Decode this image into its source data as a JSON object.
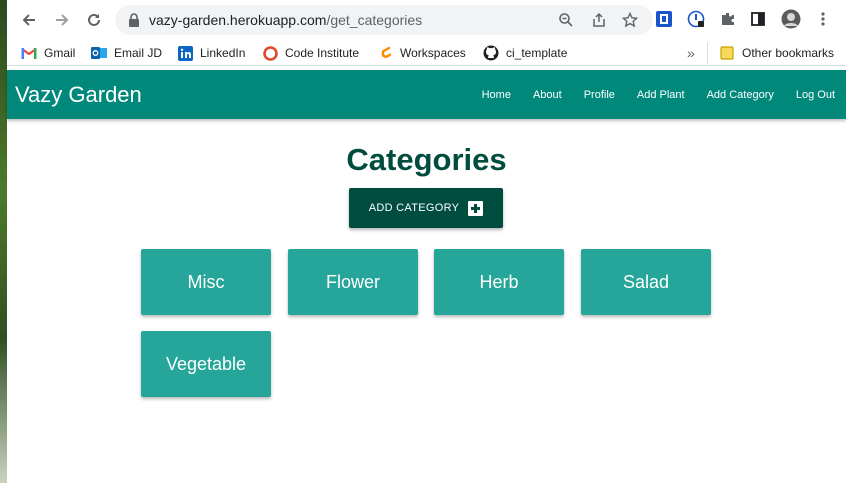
{
  "browser": {
    "url_domain": "vazy-garden.herokuapp.com",
    "url_path": "/get_categories",
    "bookmarks": [
      {
        "label": "Gmail",
        "icon": "gmail-icon"
      },
      {
        "label": "Email JD",
        "icon": "outlook-icon"
      },
      {
        "label": "LinkedIn",
        "icon": "linkedin-icon"
      },
      {
        "label": "Code Institute",
        "icon": "code-institute-icon"
      },
      {
        "label": "Workspaces",
        "icon": "gitpod-icon"
      },
      {
        "label": "ci_template",
        "icon": "github-icon"
      }
    ],
    "overflow_label": "»",
    "other_bookmarks": "Other bookmarks"
  },
  "navbar": {
    "brand": "Vazy Garden",
    "links": [
      "Home",
      "About",
      "Profile",
      "Add Plant",
      "Add Category",
      "Log Out"
    ]
  },
  "main": {
    "title": "Categories",
    "add_button_label": "ADD CATEGORY",
    "categories": [
      "Misc",
      "Flower",
      "Herb",
      "Salad",
      "Vegetable"
    ]
  },
  "colors": {
    "navbar": "#00897b",
    "title": "#004d40",
    "button": "#004d40",
    "card": "#26a69a"
  }
}
